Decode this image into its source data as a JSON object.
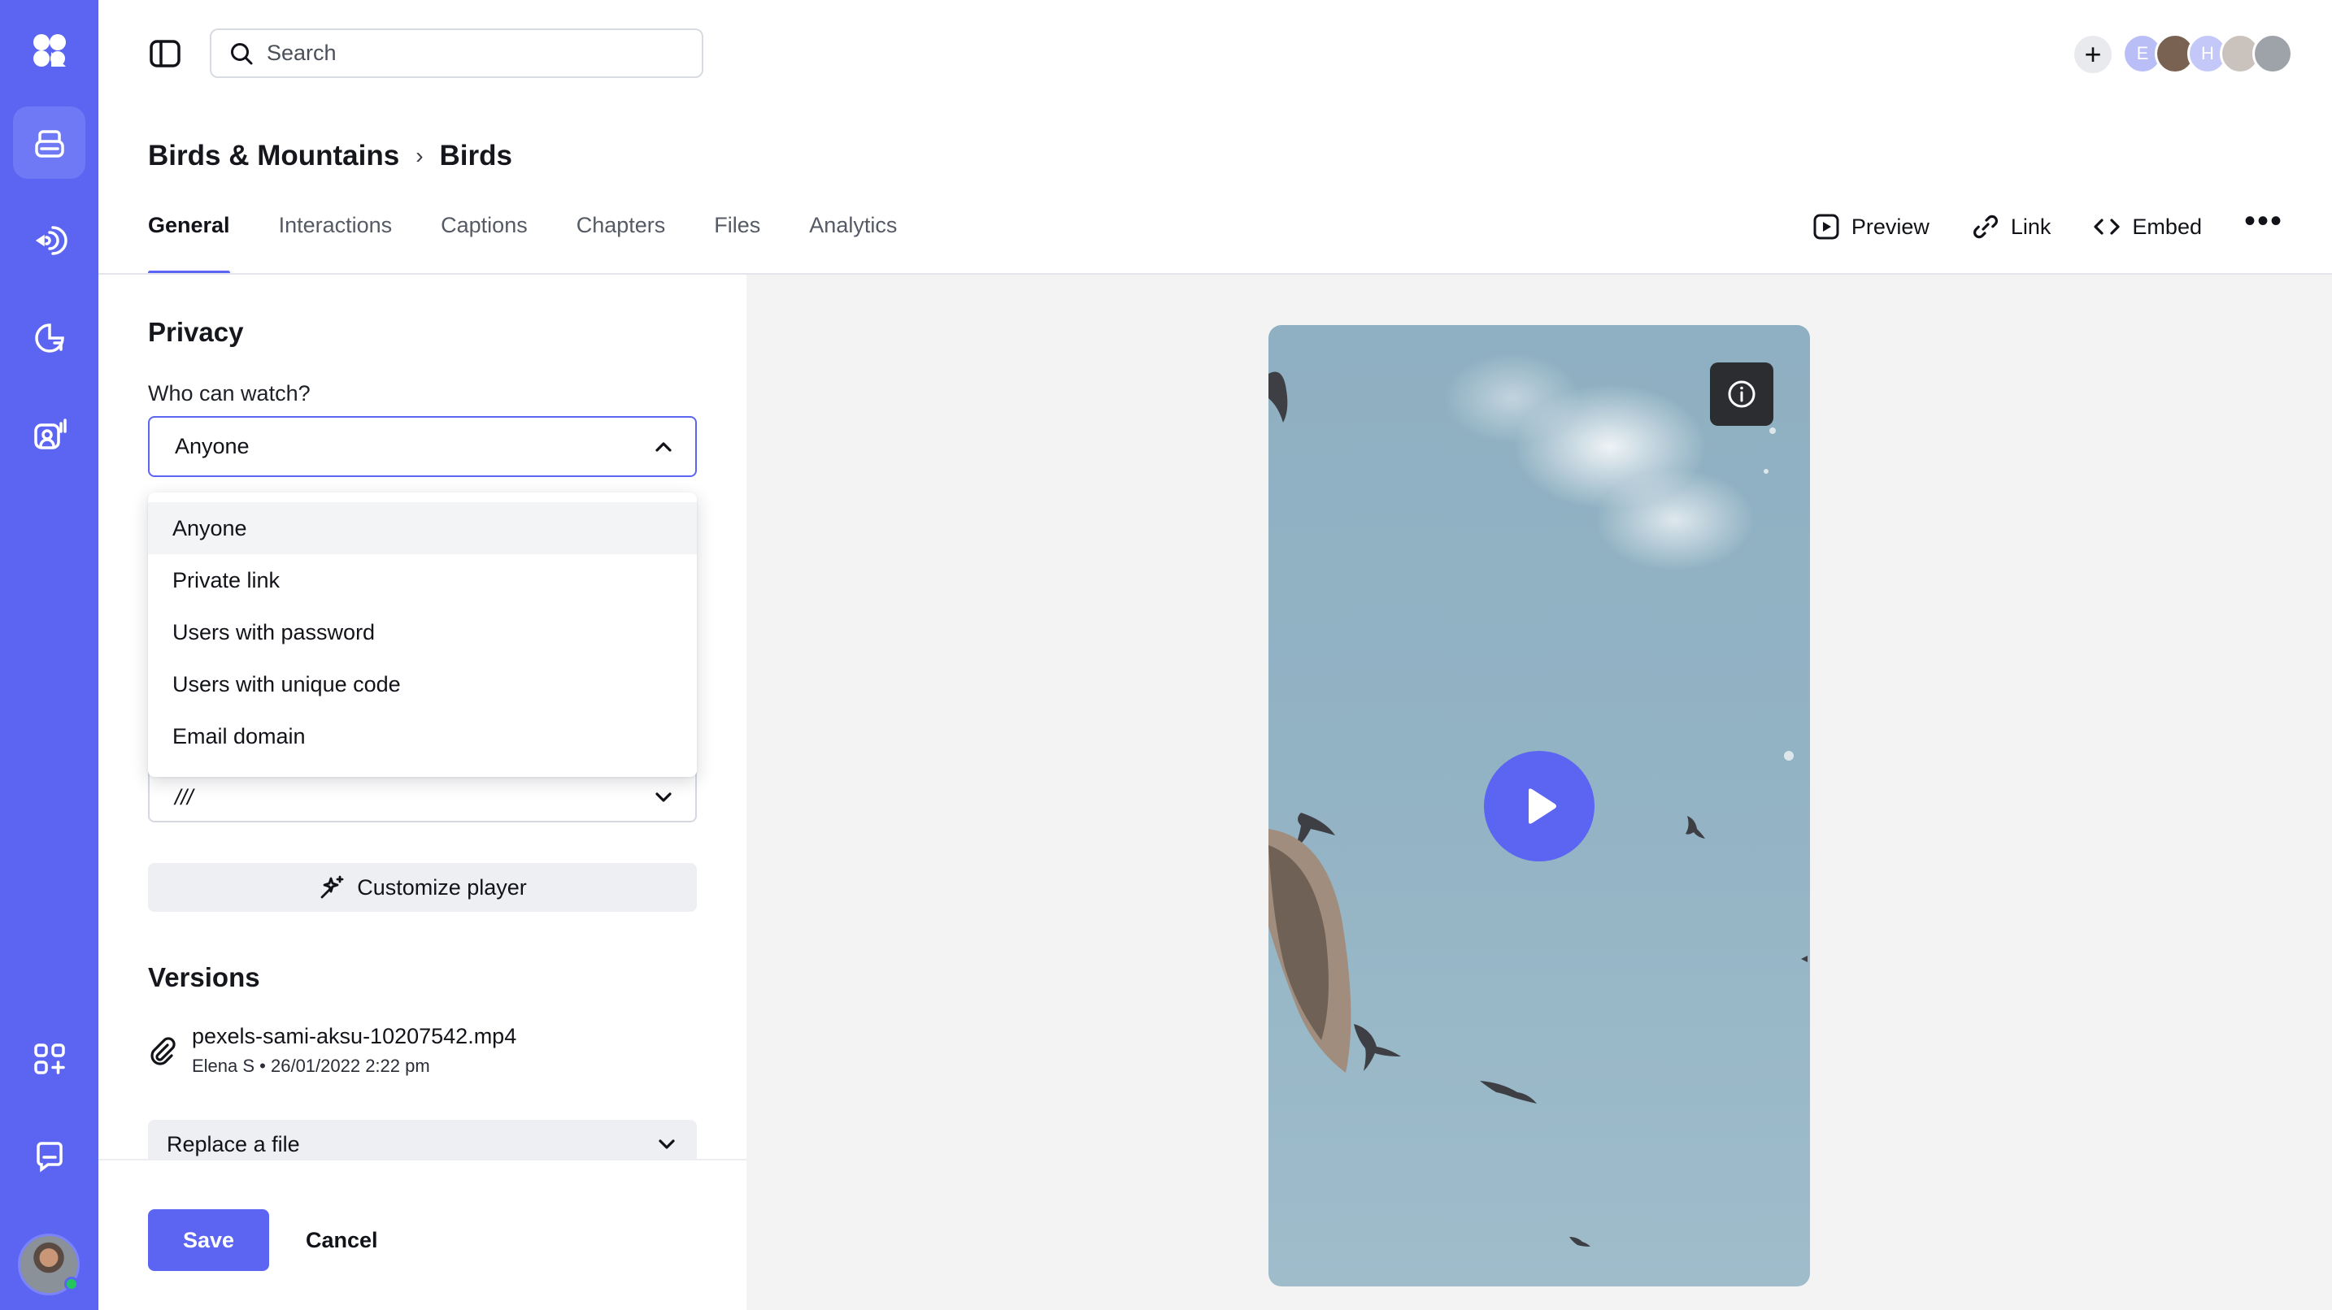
{
  "app": {
    "accent_color": "#5b65f2",
    "rail_items": [
      {
        "name": "videos",
        "icon": "library-icon",
        "active": true
      },
      {
        "name": "broadcast",
        "icon": "broadcast-icon",
        "active": false
      },
      {
        "name": "analytics",
        "icon": "pie-chart-icon",
        "active": false
      },
      {
        "name": "people",
        "icon": "user-analytics-icon",
        "active": false
      },
      {
        "name": "integrations",
        "icon": "apps-add-icon",
        "active": false
      },
      {
        "name": "messages",
        "icon": "chat-icon",
        "active": false
      }
    ]
  },
  "search": {
    "placeholder": "Search",
    "value": ""
  },
  "collaborators": [
    {
      "initial": "E",
      "color": "#b9bef7"
    },
    {
      "initial": "",
      "color": "#7a6253"
    },
    {
      "initial": "H",
      "color": "#c4c8f8"
    },
    {
      "initial": "",
      "color": "#c9c2bd"
    },
    {
      "initial": "",
      "color": "#9ea3a9"
    }
  ],
  "breadcrumb": {
    "parent": "Birds & Mountains",
    "current": "Birds"
  },
  "tabs": [
    {
      "label": "General",
      "active": true
    },
    {
      "label": "Interactions",
      "active": false
    },
    {
      "label": "Captions",
      "active": false
    },
    {
      "label": "Chapters",
      "active": false
    },
    {
      "label": "Files",
      "active": false
    },
    {
      "label": "Analytics",
      "active": false
    }
  ],
  "actions": {
    "preview": "Preview",
    "link": "Link",
    "embed": "Embed",
    "more": "•••"
  },
  "privacy": {
    "title": "Privacy",
    "question": "Who can watch?",
    "selected": "Anyone",
    "options": [
      "Anyone",
      "Private link",
      "Users with password",
      "Users with unique code",
      "Email domain"
    ],
    "highlighted_index": 0,
    "second_select_value": "///"
  },
  "customize_label": "Customize player",
  "versions": {
    "title": "Versions",
    "file_name": "pexels-sami-aksu-10207542.mp4",
    "meta": "Elena S • 26/01/2022 2:22 pm",
    "replace_label": "Replace a file"
  },
  "footer": {
    "save": "Save",
    "cancel": "Cancel"
  }
}
